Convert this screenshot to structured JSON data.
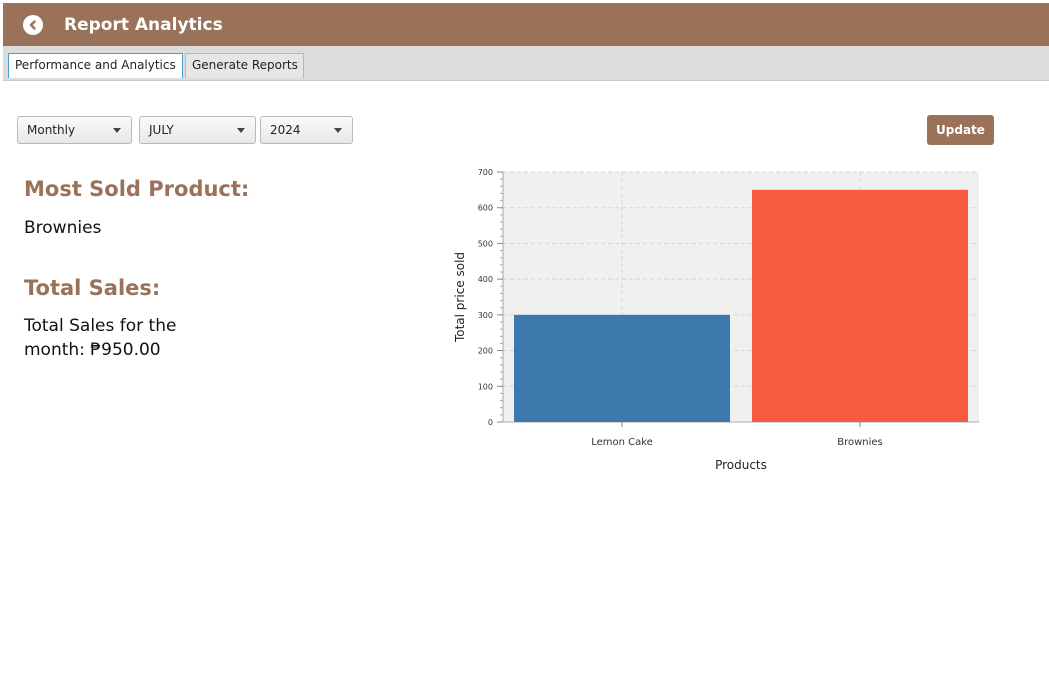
{
  "header": {
    "title": "Report Analytics",
    "back_icon": "chevron-left-circle-icon"
  },
  "tabs": [
    {
      "label": "Performance and Analytics",
      "active": true
    },
    {
      "label": "Generate Reports",
      "active": false
    }
  ],
  "filters": {
    "period": "Monthly",
    "month": "JULY",
    "year": "2024"
  },
  "update_label": "Update",
  "most_sold": {
    "heading": "Most Sold Product:",
    "value": "Brownies"
  },
  "total_sales": {
    "heading": "Total Sales:",
    "line1": "Total Sales for the",
    "line2": "month: ₱950.00"
  },
  "colors": {
    "brand": "#9a7259",
    "bar1": "#3d79ad",
    "bar2": "#f65b42"
  },
  "chart_data": {
    "type": "bar",
    "categories": [
      "Lemon Cake",
      "Brownies"
    ],
    "values": [
      300,
      650
    ],
    "colors": [
      "#3d79ad",
      "#f65b42"
    ],
    "xlabel": "Products",
    "ylabel": "Total price sold",
    "ylim": [
      0,
      700
    ],
    "yticks": [
      0,
      100,
      200,
      300,
      400,
      500,
      600,
      700
    ],
    "grid": true
  }
}
